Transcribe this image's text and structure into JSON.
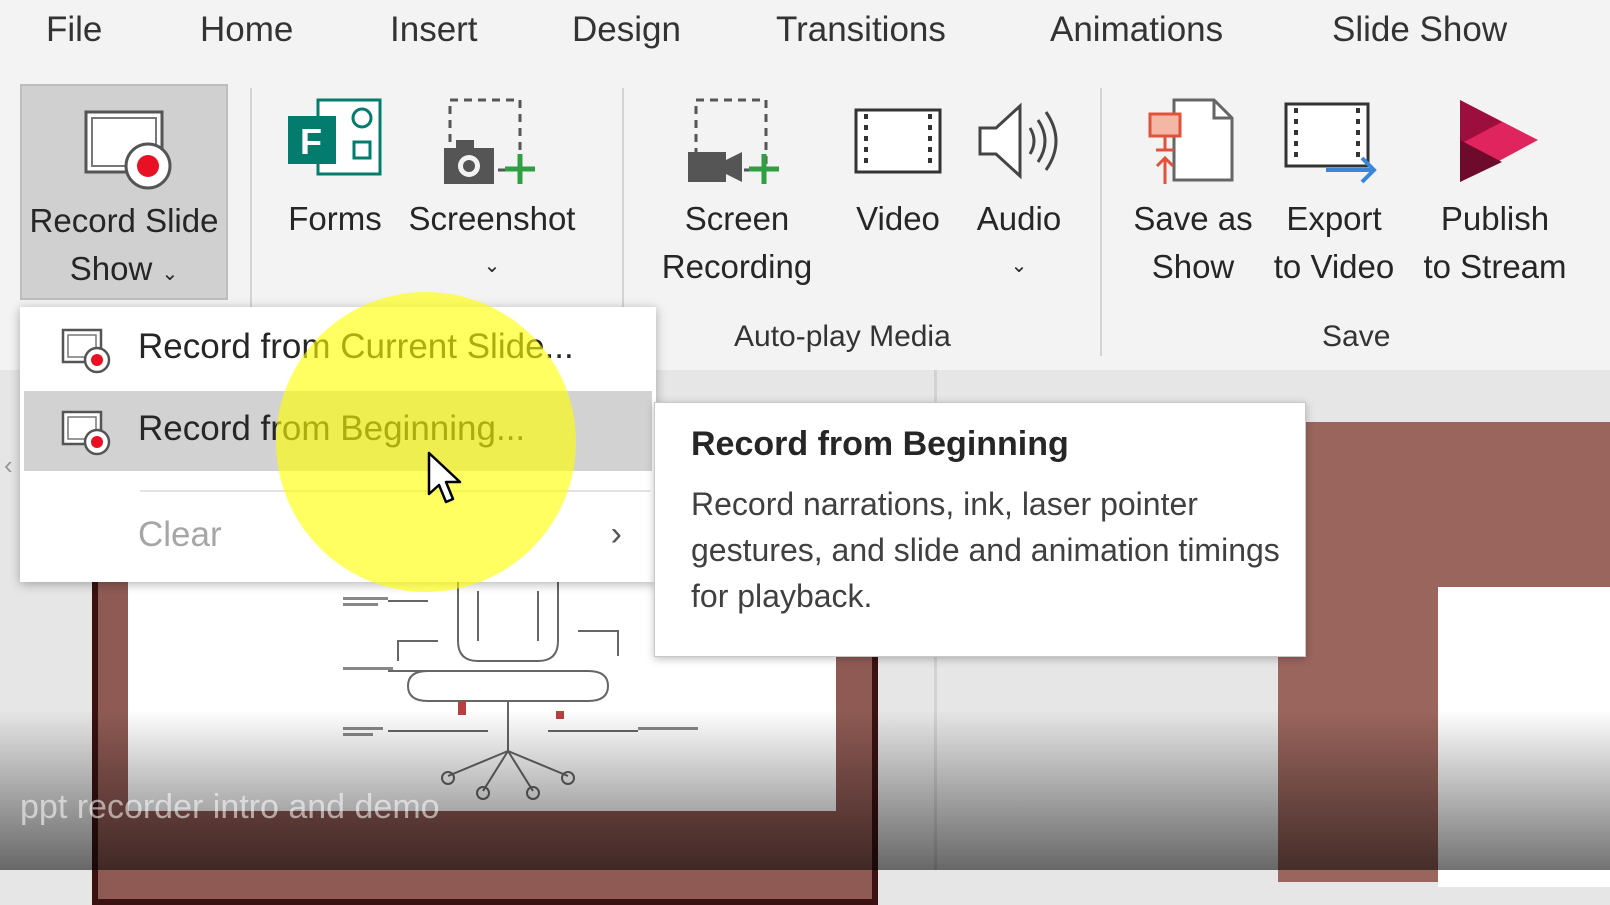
{
  "menu": [
    "File",
    "Home",
    "Insert",
    "Design",
    "Transitions",
    "Animations",
    "Slide Show"
  ],
  "ribbon": {
    "record": {
      "line1": "Record Slide",
      "line2": "Show"
    },
    "forms": "Forms",
    "screenshot": "Screenshot",
    "screen_recording": {
      "line1": "Screen",
      "line2": "Recording"
    },
    "video": "Video",
    "audio": "Audio",
    "save_as_show": {
      "line1": "Save as",
      "line2": "Show"
    },
    "export": {
      "line1": "Export",
      "line2": "to Video"
    },
    "publish": {
      "line1": "Publish",
      "line2": "to Stream"
    },
    "groups": {
      "autoplay": "Auto-play Media",
      "save": "Save"
    }
  },
  "dropdown": {
    "items": [
      {
        "label": "Record from Current Slide...",
        "state": "normal"
      },
      {
        "label": "Record from Beginning...",
        "state": "hover"
      },
      {
        "label": "Clear",
        "state": "disabled"
      }
    ]
  },
  "tooltip": {
    "title": "Record from Beginning",
    "body": "Record narrations, ink, laser pointer gestures, and slide and animation timings for playback."
  },
  "watermark": "ppt recorder intro and demo",
  "colors": {
    "accent_red": "#e81123",
    "forms_teal": "#037c6e",
    "stream_pink": "#c30052",
    "slide_brown": "#8f5a54",
    "highlight": "#ffff00"
  }
}
